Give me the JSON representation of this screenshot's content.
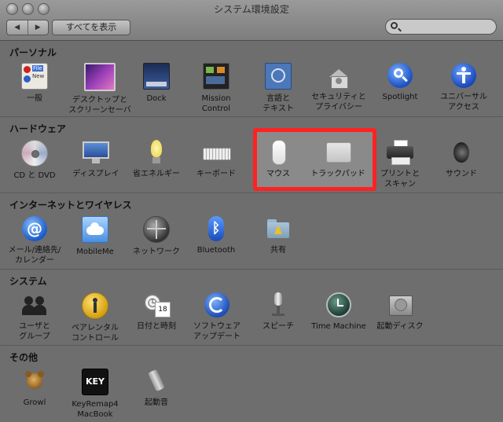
{
  "window": {
    "title": "システム環境設定",
    "back_glyph": "◀",
    "forward_glyph": "▶"
  },
  "toolbar": {
    "show_all": "すべてを表示",
    "search_placeholder": ""
  },
  "sections": [
    {
      "title": "パーソナル",
      "items": [
        {
          "label": "一般",
          "icon": "general-icon"
        },
        {
          "label": "デスクトップと\nスクリーンセーバ",
          "icon": "desktop-icon"
        },
        {
          "label": "Dock",
          "icon": "dock-icon"
        },
        {
          "label": "Mission\nControl",
          "icon": "mission-control-icon"
        },
        {
          "label": "言語と\nテキスト",
          "icon": "language-icon"
        },
        {
          "label": "セキュリティと\nプライバシー",
          "icon": "security-icon"
        },
        {
          "label": "Spotlight",
          "icon": "spotlight-icon"
        },
        {
          "label": "ユニバーサル\nアクセス",
          "icon": "accessibility-icon"
        }
      ]
    },
    {
      "title": "ハードウェア",
      "items": [
        {
          "label": "CD と DVD",
          "icon": "cd-icon"
        },
        {
          "label": "ディスプレイ",
          "icon": "display-icon"
        },
        {
          "label": "省エネルギー",
          "icon": "energy-icon"
        },
        {
          "label": "キーボード",
          "icon": "keyboard-icon"
        },
        {
          "label": "マウス",
          "icon": "mouse-icon"
        },
        {
          "label": "トラックパッド",
          "icon": "trackpad-icon"
        },
        {
          "label": "プリントと\nスキャン",
          "icon": "printer-icon"
        },
        {
          "label": "サウンド",
          "icon": "sound-icon"
        }
      ]
    },
    {
      "title": "インターネットとワイヤレス",
      "items": [
        {
          "label": "メール/連絡先/\nカレンダー",
          "icon": "mail-icon"
        },
        {
          "label": "MobileMe",
          "icon": "mobileme-icon"
        },
        {
          "label": "ネットワーク",
          "icon": "network-icon"
        },
        {
          "label": "Bluetooth",
          "icon": "bluetooth-icon"
        },
        {
          "label": "共有",
          "icon": "sharing-icon"
        }
      ]
    },
    {
      "title": "システム",
      "items": [
        {
          "label": "ユーザと\nグループ",
          "icon": "users-icon"
        },
        {
          "label": "ペアレンタル\nコントロール",
          "icon": "parental-icon"
        },
        {
          "label": "日付と時刻",
          "icon": "datetime-icon"
        },
        {
          "label": "ソフトウェア\nアップデート",
          "icon": "update-icon"
        },
        {
          "label": "スピーチ",
          "icon": "speech-icon"
        },
        {
          "label": "Time Machine",
          "icon": "timemachine-icon"
        },
        {
          "label": "起動ディスク",
          "icon": "startup-disk-icon"
        }
      ]
    },
    {
      "title": "その他",
      "items": [
        {
          "label": "Growl",
          "icon": "growl-icon"
        },
        {
          "label": "KeyRemap4\nMacBook",
          "icon": "keyremap-icon"
        },
        {
          "label": "起動音",
          "icon": "startup-sound-icon"
        }
      ]
    }
  ],
  "icon_text": {
    "keyremap": "KEY",
    "file_tab": "File",
    "new_tab": "New",
    "calendar_day": "18",
    "clock_glyph": "◷",
    "bluetooth_glyph": "ᛒ",
    "at_glyph": "@"
  },
  "colors": {
    "highlight": "#ff2222",
    "background": "#6e6e6e"
  }
}
